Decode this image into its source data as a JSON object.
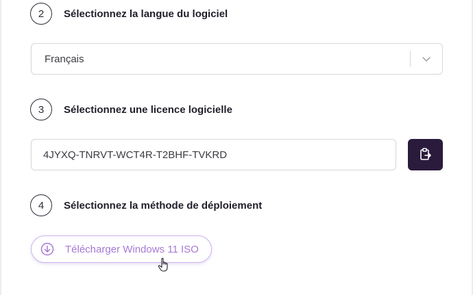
{
  "steps": [
    {
      "number": "2",
      "title": "Sélectionnez la langue du logiciel"
    },
    {
      "number": "3",
      "title": "Sélectionnez une licence logicielle"
    },
    {
      "number": "4",
      "title": "Sélectionnez la méthode de déploiement"
    }
  ],
  "language_select": {
    "value": "Français",
    "icon": "chevron-down-icon"
  },
  "license": {
    "value": "4JYXQ-TNRVT-WCT4R-T2BHF-TVKRD",
    "copy_icon": "clipboard-copy-icon"
  },
  "download": {
    "label": "Télécharger Windows 11 ISO",
    "icon": "download-circle-icon"
  },
  "colors": {
    "accent": "#a679d6",
    "accent_border": "#cbb2ec",
    "copy_button_bg": "#2a1b3d",
    "text": "#1f1f2b",
    "border": "#d6d6de"
  }
}
